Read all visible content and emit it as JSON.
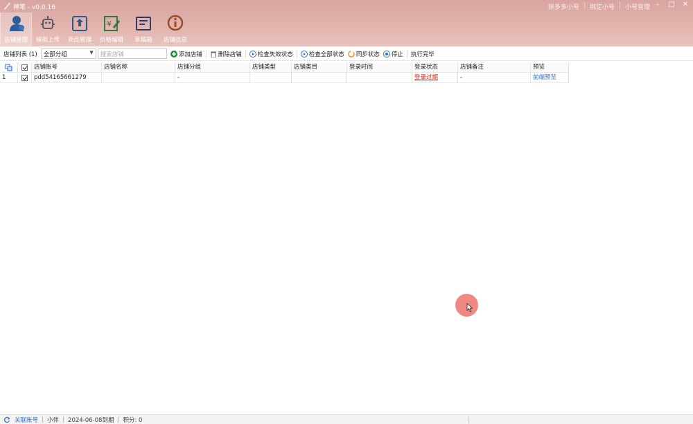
{
  "window": {
    "title": "神笔 - v0.0.16",
    "title_links": [
      "拼多多小号",
      "绑定小号",
      "小号管理"
    ],
    "controls": {
      "minimize": "–",
      "maximize": "□",
      "close": "✕"
    }
  },
  "ribbon": [
    {
      "label": "店铺管理",
      "icon": "user-store-icon",
      "active": true
    },
    {
      "label": "模拟上传",
      "icon": "robot-icon",
      "active": false
    },
    {
      "label": "商品管理",
      "icon": "upload-box-icon",
      "active": false
    },
    {
      "label": "价格编辑",
      "icon": "price-edit-icon",
      "active": false
    },
    {
      "label": "草稿箱",
      "icon": "drafts-icon",
      "active": false
    },
    {
      "label": "店铺信息",
      "icon": "info-icon",
      "active": false
    }
  ],
  "toolbar": {
    "list_label": "店铺列表 (1)",
    "group_select": "全部分组",
    "search_placeholder": "搜索店铺",
    "add_shop": "添加店铺",
    "delete_shop": "删除店铺",
    "check_failed": "检查失效状态",
    "check_all": "检查全部状态",
    "sync_status": "同步状态",
    "stop": "停止",
    "task_done": "执行完毕"
  },
  "table": {
    "headers": [
      "",
      "",
      "店铺账号",
      "店铺名称",
      "店铺分组",
      "店铺类型",
      "店铺类目",
      "登录时间",
      "登录状态",
      "店铺备注",
      "预览"
    ],
    "rows": [
      {
        "index": "1",
        "checked": true,
        "account": "pdd54165661279",
        "name": "",
        "group": "-",
        "type": "",
        "category": "",
        "login_time": "",
        "login_status": "登录过期",
        "remark": "-",
        "preview": "前端预览"
      }
    ]
  },
  "statusbar": {
    "link": "关联账号",
    "user": "小伴",
    "expiry": "2024-06-08到期",
    "points": "积分: 0"
  },
  "colors": {
    "header_top": "#d8a4a0",
    "login_expired": "#d12b1f",
    "link": "#3b6fc7",
    "cursor": "#ef7f79"
  }
}
